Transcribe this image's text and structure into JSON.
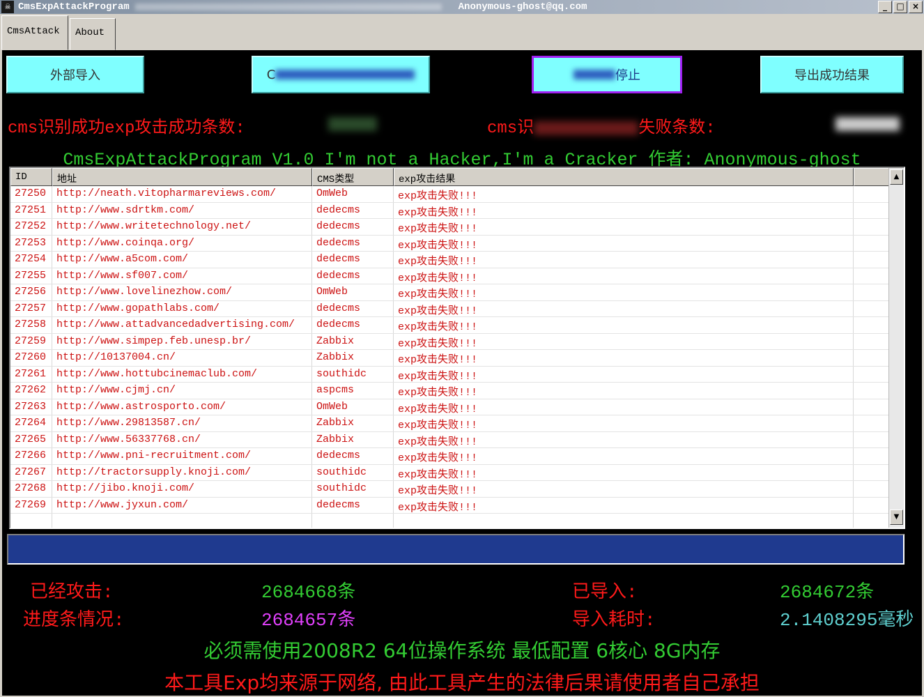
{
  "window": {
    "title": "CmsExpAttackProgram",
    "email": "Anonymous-ghost@qq.com",
    "controls": [
      "_",
      "□",
      "×"
    ]
  },
  "tabs": [
    {
      "label": "CmsAttack",
      "active": true
    },
    {
      "label": "About",
      "active": false
    }
  ],
  "buttons": {
    "import": "外部导入",
    "start_prefix": "C",
    "stop_suffix": "停止",
    "export": "导出成功结果"
  },
  "stats_top": {
    "success_label": "cms识别成功exp攻击成功条数:",
    "fail_label_prefix": "cms识",
    "fail_label_suffix": "失败条数:"
  },
  "banner": "CmsExpAttackProgram V1.0 I'm not a Hacker,I'm a Cracker 作者: Anonymous-ghost",
  "table": {
    "columns": [
      "ID",
      "地址",
      "CMS类型",
      "exp攻击结果"
    ],
    "rows": [
      [
        "27250",
        "http://neath.vitopharmareviews.com/",
        "OmWeb",
        "exp攻击失败!!!"
      ],
      [
        "27251",
        "http://www.sdrtkm.com/",
        "dedecms",
        "exp攻击失败!!!"
      ],
      [
        "27252",
        "http://www.writetechnology.net/",
        "dedecms",
        "exp攻击失败!!!"
      ],
      [
        "27253",
        "http://www.coinqa.org/",
        "dedecms",
        "exp攻击失败!!!"
      ],
      [
        "27254",
        "http://www.a5com.com/",
        "dedecms",
        "exp攻击失败!!!"
      ],
      [
        "27255",
        "http://www.sf007.com/",
        "dedecms",
        "exp攻击失败!!!"
      ],
      [
        "27256",
        "http://www.lovelinezhow.com/",
        "OmWeb",
        "exp攻击失败!!!"
      ],
      [
        "27257",
        "http://www.gopathlabs.com/",
        "dedecms",
        "exp攻击失败!!!"
      ],
      [
        "27258",
        "http://www.attadvancedadvertising.com/",
        "dedecms",
        "exp攻击失败!!!"
      ],
      [
        "27259",
        "http://www.simpep.feb.unesp.br/",
        "Zabbix",
        "exp攻击失败!!!"
      ],
      [
        "27260",
        "http://10137004.cn/",
        "Zabbix",
        "exp攻击失败!!!"
      ],
      [
        "27261",
        "http://www.hottubcinemaclub.com/",
        "southidc",
        "exp攻击失败!!!"
      ],
      [
        "27262",
        "http://www.cjmj.cn/",
        "aspcms",
        "exp攻击失败!!!"
      ],
      [
        "27263",
        "http://www.astrosporto.com/",
        "OmWeb",
        "exp攻击失败!!!"
      ],
      [
        "27264",
        "http://www.29813587.cn/",
        "Zabbix",
        "exp攻击失败!!!"
      ],
      [
        "27265",
        "http://www.56337768.cn/",
        "Zabbix",
        "exp攻击失败!!!"
      ],
      [
        "27266",
        "http://www.pni-recruitment.com/",
        "dedecms",
        "exp攻击失败!!!"
      ],
      [
        "27267",
        "http://tractorsupply.knoji.com/",
        "southidc",
        "exp攻击失败!!!"
      ],
      [
        "27268",
        "http://jibo.knoji.com/",
        "southidc",
        "exp攻击失败!!!"
      ],
      [
        "27269",
        "http://www.jyxun.com/",
        "dedecms",
        "exp攻击失败!!!"
      ]
    ]
  },
  "progress": {
    "value": 1.0,
    "color": "#1a2f7a"
  },
  "stats_bottom": {
    "attacked_label": "已经攻击:",
    "attacked_value": "2684668条",
    "imported_label": "已导入:",
    "imported_value": "2684672条",
    "progress_label": "进度条情况:",
    "progress_value": "2684657条",
    "elapsed_label": "导入耗时:",
    "elapsed_value": "2.1408295毫秒"
  },
  "requirement": "必须需使用2008R2 64位操作系统 最低配置 6核心 8G内存",
  "disclaimer": "本工具Exp均来源于网络, 由此工具产生的法律后果请使用者自己承担",
  "colors": {
    "accent_red": "#ff1a1a",
    "accent_green": "#33cc33",
    "button_cyan": "#7fffff"
  }
}
